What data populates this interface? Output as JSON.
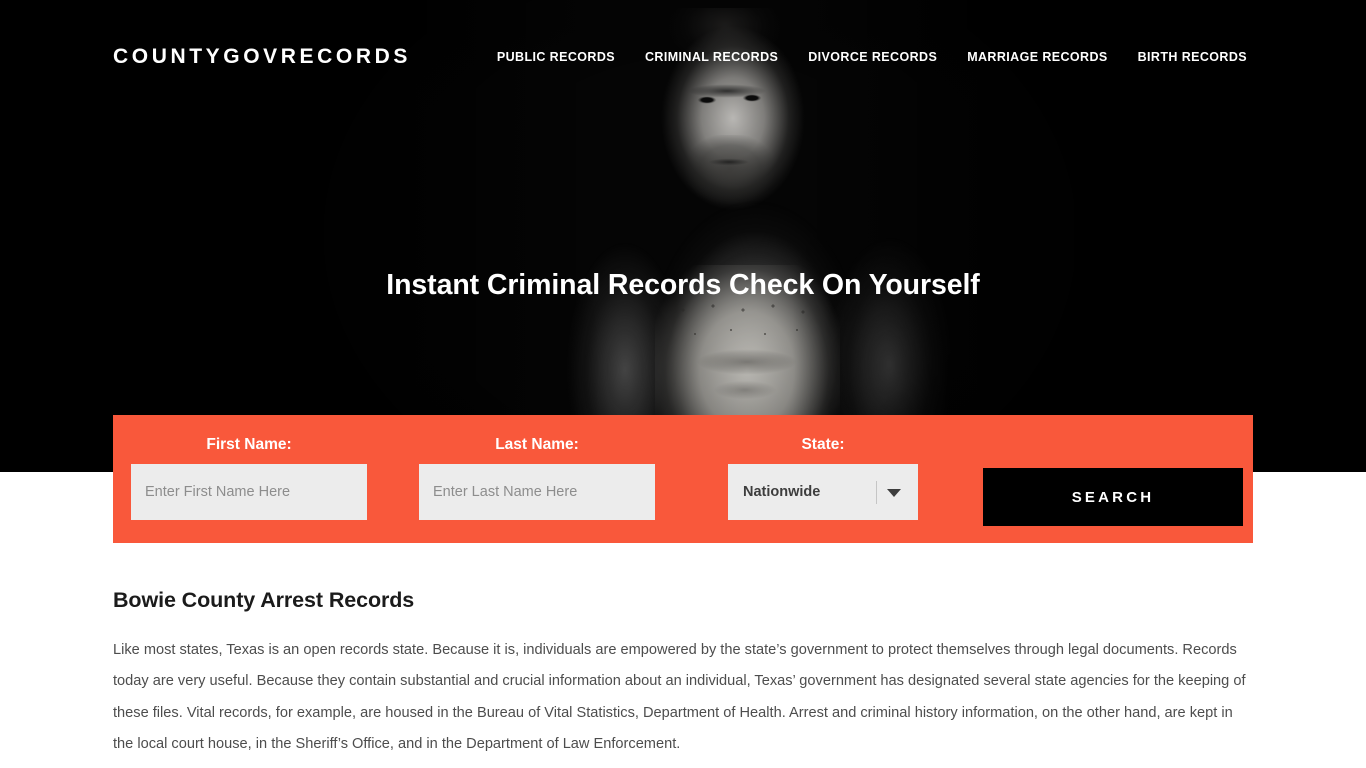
{
  "site": {
    "logo": "COUNTYGOVRECORDS",
    "accent_color": "#F9583B",
    "hero_background_color": "#000000",
    "button_color": "#000000",
    "input_background_color": "#ECECEC"
  },
  "nav": {
    "items": [
      {
        "label": "PUBLIC RECORDS"
      },
      {
        "label": "CRIMINAL RECORDS"
      },
      {
        "label": "DIVORCE RECORDS"
      },
      {
        "label": "MARRIAGE RECORDS"
      },
      {
        "label": "BIRTH RECORDS"
      }
    ]
  },
  "hero": {
    "headline": "Instant Criminal Records Check On Yourself"
  },
  "search_form": {
    "first_name": {
      "label": "First Name:",
      "placeholder": "Enter First Name Here",
      "value": ""
    },
    "last_name": {
      "label": "Last Name:",
      "placeholder": "Enter Last Name Here",
      "value": ""
    },
    "state": {
      "label": "State:",
      "selected": "Nationwide"
    },
    "submit_label": "SEARCH"
  },
  "content": {
    "title": "Bowie County Arrest Records",
    "paragraph": "Like most states, Texas is an open records state. Because it is, individuals are empowered by the state’s government to protect themselves through legal documents. Records today are very useful. Because they contain substantial and crucial information about an individual, Texas’ government has designated several state agencies for the keeping of these files. Vital records, for example, are housed in the Bureau of Vital Statistics, Department of Health. Arrest and criminal history information, on the other hand, are kept in the local court house, in the Sheriff’s Office, and in the Department of Law Enforcement."
  }
}
